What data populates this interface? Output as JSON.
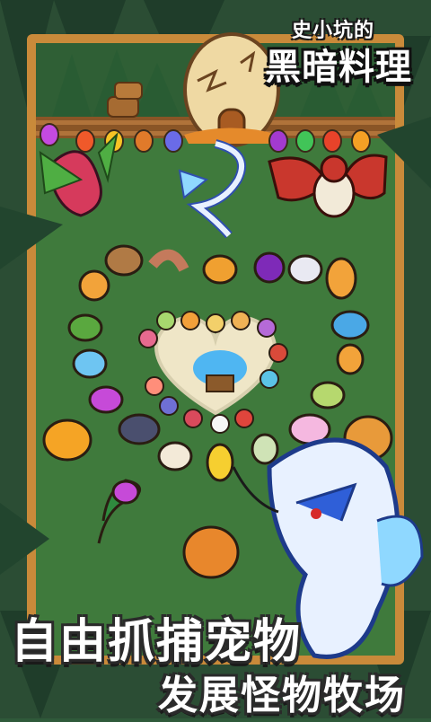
{
  "title": {
    "small": "史小坑的",
    "big": "黑暗料理"
  },
  "slogan": {
    "line1": "自由抓捕宠物",
    "line2": "发展怪物牧场"
  },
  "colors": {
    "grass": "#3f7a3c",
    "fence_wood": "#c98a3a",
    "forest_dark": "#2b4d34",
    "text_outline": "#1b1b1b"
  }
}
